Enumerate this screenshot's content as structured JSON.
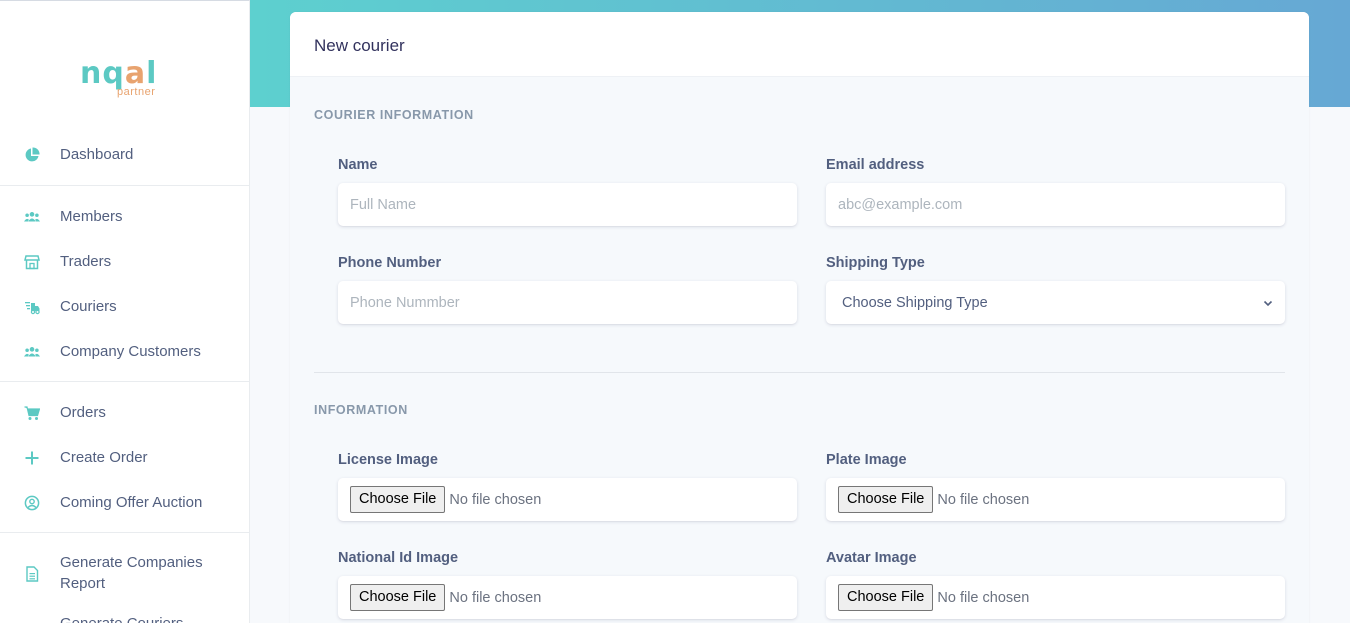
{
  "logo": {
    "main_part1": "nq",
    "main_part2": "a",
    "main_part3": "l",
    "sub": "partner"
  },
  "sidebar": {
    "items": [
      {
        "label": "Dashboard",
        "icon": "pie-chart-icon"
      },
      {
        "label": "Members",
        "icon": "users-icon"
      },
      {
        "label": "Traders",
        "icon": "store-icon"
      },
      {
        "label": "Couriers",
        "icon": "shipping-fast-icon"
      },
      {
        "label": "Company Customers",
        "icon": "users-icon"
      },
      {
        "label": "Orders",
        "icon": "cart-icon"
      },
      {
        "label": "Create Order",
        "icon": "plus-icon"
      },
      {
        "label": "Coming Offer Auction",
        "icon": "user-circle-icon"
      },
      {
        "label": "Generate Companies Report",
        "icon": "file-icon"
      },
      {
        "label": "Generate Couriers",
        "icon": "file-icon"
      }
    ]
  },
  "card": {
    "title": "New courier",
    "sections": {
      "courier_info": "COURIER INFORMATION",
      "information": "INFORMATION"
    },
    "fields": {
      "name": {
        "label": "Name",
        "placeholder": "Full Name"
      },
      "email": {
        "label": "Email address",
        "placeholder": "abc@example.com"
      },
      "phone": {
        "label": "Phone Number",
        "placeholder": "Phone Nummber"
      },
      "shipping": {
        "label": "Shipping Type",
        "value": "Choose Shipping Type"
      },
      "license": {
        "label": "License Image",
        "button": "Choose File",
        "status": "No file chosen"
      },
      "plate": {
        "label": "Plate Image",
        "button": "Choose File",
        "status": "No file chosen"
      },
      "national_id": {
        "label": "National Id Image",
        "button": "Choose File",
        "status": "No file chosen"
      },
      "avatar": {
        "label": "Avatar Image",
        "button": "Choose File",
        "status": "No file chosen"
      }
    }
  },
  "colors": {
    "accent": "#5cc9c3",
    "logo_orange": "#e8a36f",
    "hero_start": "#5dd0cf",
    "hero_end": "#66a8d4"
  }
}
